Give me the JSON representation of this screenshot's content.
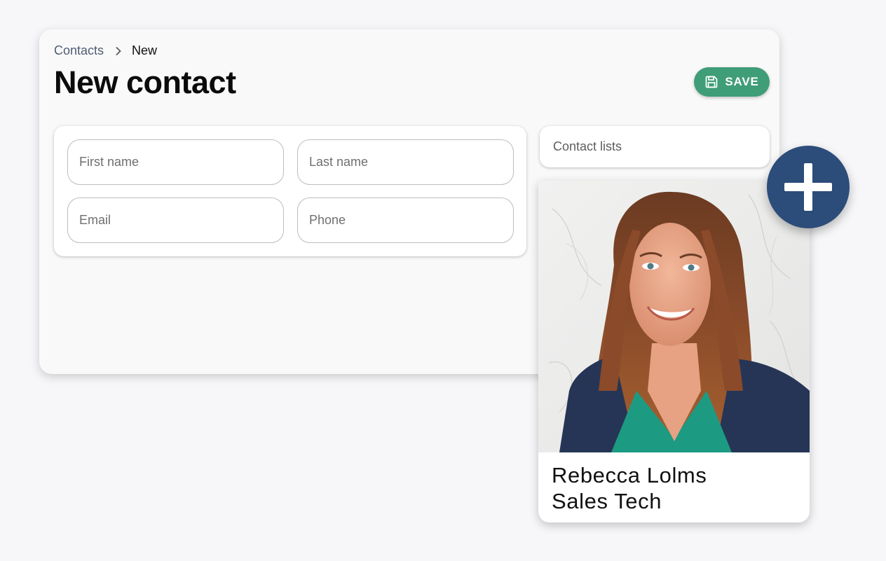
{
  "breadcrumb": {
    "parent": "Contacts",
    "current": "New"
  },
  "page": {
    "title": "New contact"
  },
  "toolbar": {
    "save_label": "SAVE"
  },
  "form": {
    "first_name": {
      "placeholder": "First name",
      "value": ""
    },
    "last_name": {
      "placeholder": "Last name",
      "value": ""
    },
    "email": {
      "placeholder": "Email",
      "value": ""
    },
    "phone": {
      "placeholder": "Phone",
      "value": ""
    }
  },
  "contact_lists": {
    "label": "Contact lists"
  },
  "profile": {
    "name": "Rebecca Lolms",
    "role": "Sales Tech"
  },
  "icons": {
    "breadcrumb_separator": "chevron-right-icon",
    "save": "floppy-disk-icon",
    "add": "plus-icon"
  },
  "colors": {
    "save_button": "#3f9d78",
    "add_button": "#2c4c7a",
    "page_background": "#f7f7f9"
  }
}
